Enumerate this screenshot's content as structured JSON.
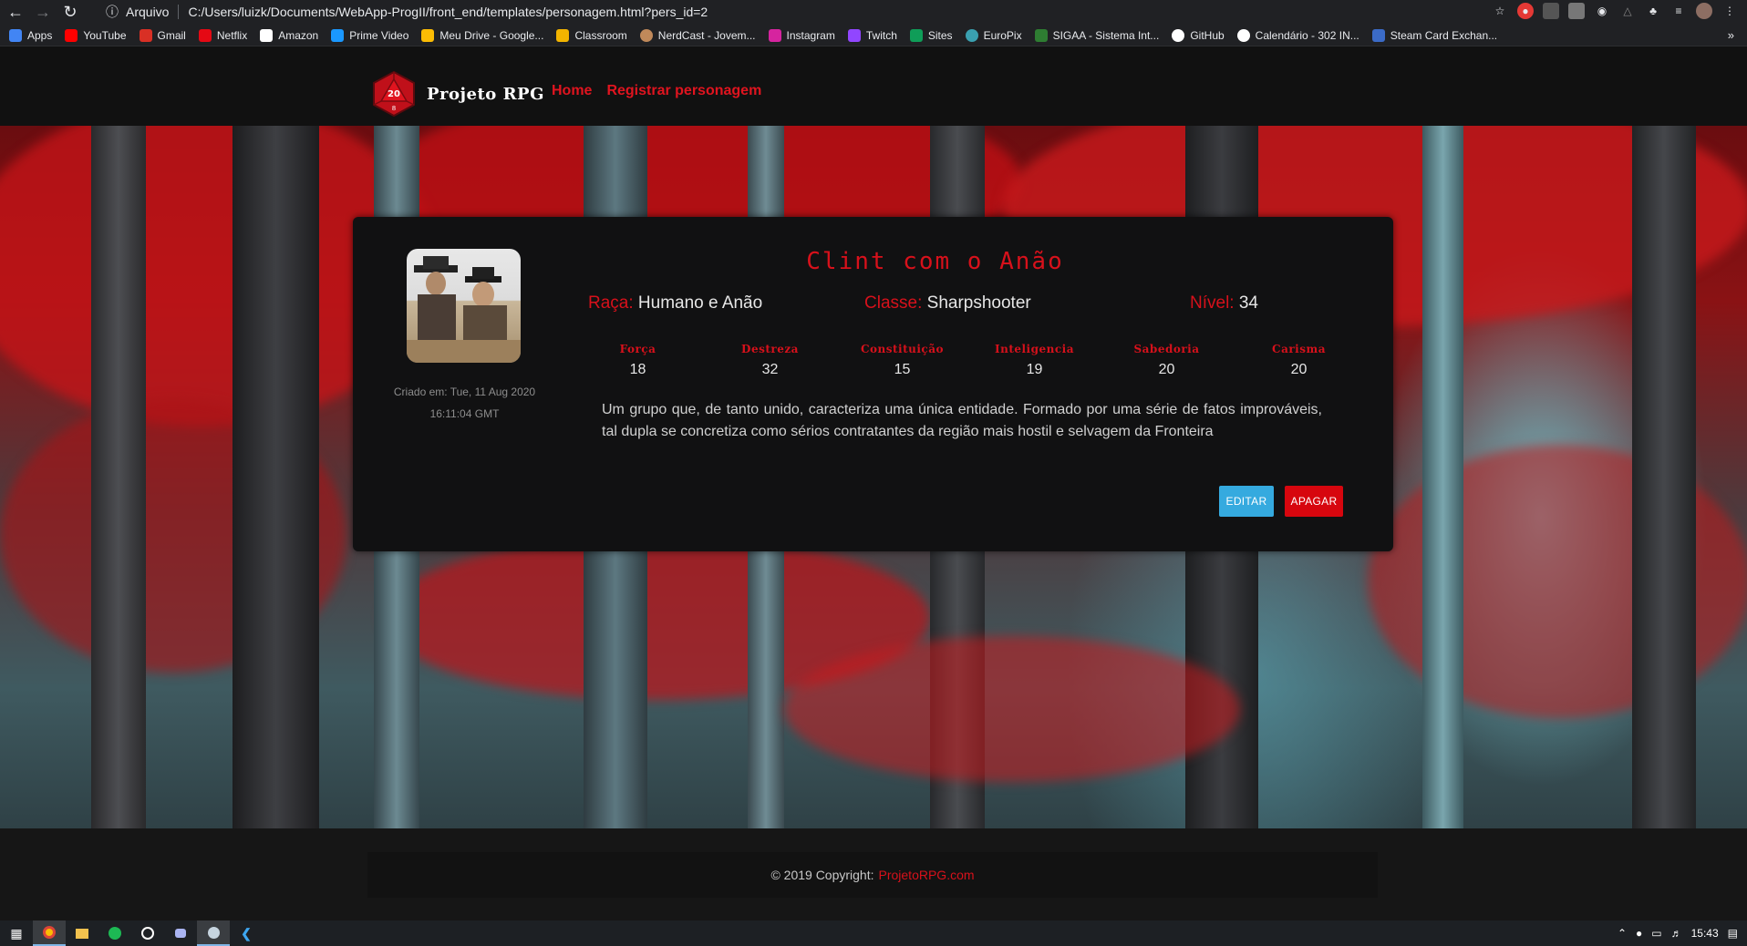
{
  "browser": {
    "scheme_label": "Arquivo",
    "url": "C:/Users/luizk/Documents/WebApp-ProgII/front_end/templates/personagem.html?pers_id=2",
    "bookmarks": [
      {
        "label": "Apps",
        "color": "#4285f4"
      },
      {
        "label": "YouTube",
        "color": "#ff0000"
      },
      {
        "label": "Gmail",
        "color": "#d93025"
      },
      {
        "label": "Netflix",
        "color": "#e50914"
      },
      {
        "label": "Amazon",
        "color": "#ffffff"
      },
      {
        "label": "Prime Video",
        "color": "#1a98ff"
      },
      {
        "label": "Meu Drive - Google...",
        "color": "#fbbc04"
      },
      {
        "label": "Classroom",
        "color": "#f2b400"
      },
      {
        "label": "NerdCast - Jovem...",
        "color": "#c0895a"
      },
      {
        "label": "Instagram",
        "color": "#d6249f"
      },
      {
        "label": "Twitch",
        "color": "#9146ff"
      },
      {
        "label": "Sites",
        "color": "#0f9d58"
      },
      {
        "label": "EuroPix",
        "color": "#3aa0b0"
      },
      {
        "label": "SIGAA - Sistema Int...",
        "color": "#2e7d32"
      },
      {
        "label": "GitHub",
        "color": "#ffffff"
      },
      {
        "label": "Calendário - 302 IN...",
        "color": "#ffffff"
      },
      {
        "label": "Steam Card Exchan...",
        "color": "#3b6bc7"
      }
    ]
  },
  "navbar": {
    "brand": "Projeto RPG",
    "logo_number": "20",
    "logo_number_small": "8",
    "links": [
      "Home",
      "Registrar personagem"
    ]
  },
  "character": {
    "name": "Clint com o Anão",
    "created_line1": "Criado em: Tue, 11 Aug 2020",
    "created_line2": "16:11:04 GMT",
    "race_label": "Raça:",
    "race": "Humano e Anão",
    "class_label": "Classe:",
    "class": "Sharpshooter",
    "level_label": "Nível:",
    "level": "34",
    "attributes": [
      {
        "label": "Força",
        "value": "18"
      },
      {
        "label": "Destreza",
        "value": "32"
      },
      {
        "label": "Constituição",
        "value": "15"
      },
      {
        "label": "Inteligencia",
        "value": "19"
      },
      {
        "label": "Sabedoria",
        "value": "20"
      },
      {
        "label": "Carisma",
        "value": "20"
      }
    ],
    "description": "Um grupo que, de tanto unido, caracteriza uma única entidade. Formado por uma série de fatos improváveis, tal dupla se concretiza como sérios contratantes da região mais hostil e selvagem da Fronteira",
    "edit_label": "EDITAR",
    "delete_label": "APAGAR"
  },
  "footer": {
    "copyright": "© 2019 Copyright:",
    "link": "ProjetoRPG.com"
  },
  "taskbar": {
    "clock": "15:43"
  },
  "colors": {
    "accent_red": "#d7111b",
    "edit_blue": "#35aadf",
    "delete_red": "#d7060e"
  }
}
